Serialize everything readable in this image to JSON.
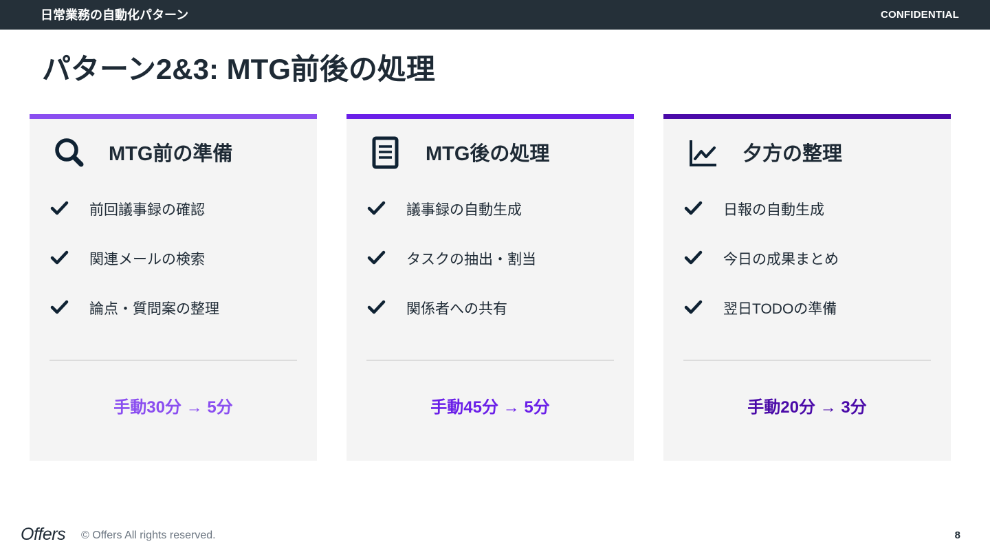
{
  "header": {
    "section_title": "日常業務の自動化パターン",
    "confidential": "CONFIDENTIAL"
  },
  "title": "パターン2&3: MTG前後の処理",
  "cards": [
    {
      "title": "MTG前の準備",
      "icon": "search-icon",
      "accent": "#8a4ef0",
      "items": [
        "前回議事録の確認",
        "関連メールの検索",
        "論点・質問案の整理"
      ],
      "result": "手動30分 → 5分"
    },
    {
      "title": "MTG後の処理",
      "icon": "document-icon",
      "accent": "#6a1fe8",
      "items": [
        "議事録の自動生成",
        "タスクの抽出・割当",
        "関係者への共有"
      ],
      "result": "手動45分 → 5分"
    },
    {
      "title": "夕方の整理",
      "icon": "line-chart-icon",
      "accent": "#4a0aa8",
      "items": [
        "日報の自動生成",
        "今日の成果まとめ",
        "翌日TODOの準備"
      ],
      "result": "手動20分 → 3分"
    }
  ],
  "footer": {
    "logo": "Offers",
    "copyright": "© Offers All rights reserved.",
    "page_number": "8"
  }
}
